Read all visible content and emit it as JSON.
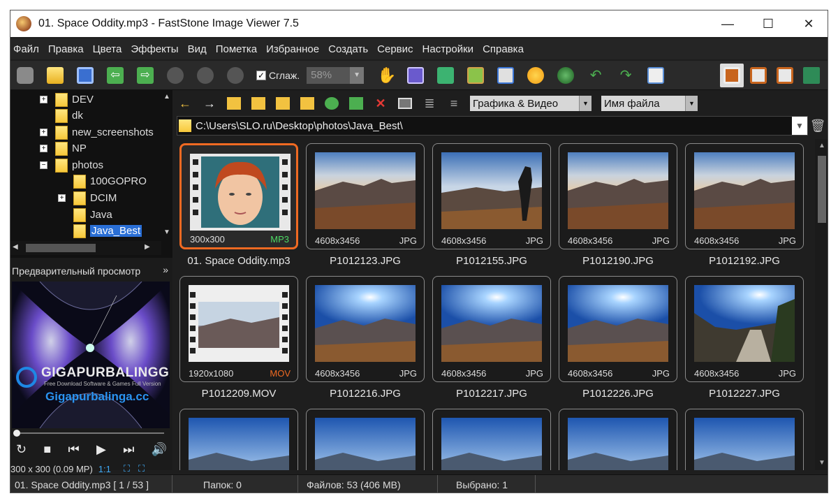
{
  "window": {
    "title": "01. Space Oddity.mp3  -  FastStone Image Viewer 7.5",
    "controls": [
      "—",
      "☐",
      "✕"
    ]
  },
  "menu": [
    "Файл",
    "Правка",
    "Цвета",
    "Эффекты",
    "Вид",
    "Пометка",
    "Избранное",
    "Создать",
    "Сервис",
    "Настройки",
    "Справка"
  ],
  "toolbar": {
    "smooth_label": "Сглаж.",
    "zoom_value": "58%"
  },
  "tree": [
    {
      "label": "DEV",
      "expander": "+"
    },
    {
      "label": "dk",
      "expander": ""
    },
    {
      "label": "new_screenshots",
      "expander": "+"
    },
    {
      "label": "NP",
      "expander": "+"
    },
    {
      "label": "photos",
      "expander": "−"
    },
    {
      "label": "100GOPRO",
      "expander": ""
    },
    {
      "label": "DCIM",
      "expander": "+"
    },
    {
      "label": "Java",
      "expander": ""
    },
    {
      "label": "Java_Best",
      "expander": ""
    }
  ],
  "preview": {
    "header": "Предварительный просмотр",
    "info": "300 x 300 (0.09 MP)",
    "ratio": "1:1",
    "watermark_brand": "GIGAPURBALINGGA",
    "watermark_tagline": "Free Download Software & Games Full Version",
    "watermark_site": "Gigapurbalinga.cc"
  },
  "filters": {
    "type": "Графика & Видео",
    "sort": "Имя файла"
  },
  "path": "C:\\Users\\SLO.ru\\Desktop\\photos\\Java_Best\\",
  "thumbnails": [
    {
      "dims": "300x300",
      "ext": "MP3",
      "name": "01. Space Oddity.mp3",
      "kind": "portrait",
      "selected": true
    },
    {
      "dims": "4608x3456",
      "ext": "JPG",
      "name": "P1012123.JPG",
      "kind": "dusk"
    },
    {
      "dims": "4608x3456",
      "ext": "JPG",
      "name": "P1012155.JPG",
      "kind": "person"
    },
    {
      "dims": "4608x3456",
      "ext": "JPG",
      "name": "P1012190.JPG",
      "kind": "dusk"
    },
    {
      "dims": "4608x3456",
      "ext": "JPG",
      "name": "P1012192.JPG",
      "kind": "dusk"
    },
    {
      "dims": "1920x1080",
      "ext": "MOV",
      "name": "P1012209.MOV",
      "kind": "film"
    },
    {
      "dims": "4608x3456",
      "ext": "JPG",
      "name": "P1012216.JPG",
      "kind": "sun"
    },
    {
      "dims": "4608x3456",
      "ext": "JPG",
      "name": "P1012217.JPG",
      "kind": "sun"
    },
    {
      "dims": "4608x3456",
      "ext": "JPG",
      "name": "P1012226.JPG",
      "kind": "sun"
    },
    {
      "dims": "4608x3456",
      "ext": "JPG",
      "name": "P1012227.JPG",
      "kind": "road"
    },
    {
      "dims": "",
      "ext": "",
      "name": "",
      "kind": "sky"
    },
    {
      "dims": "",
      "ext": "",
      "name": "",
      "kind": "sky"
    },
    {
      "dims": "",
      "ext": "",
      "name": "",
      "kind": "sky"
    },
    {
      "dims": "",
      "ext": "",
      "name": "",
      "kind": "sky"
    },
    {
      "dims": "",
      "ext": "",
      "name": "",
      "kind": "sky"
    }
  ],
  "status": {
    "file": "01. Space Oddity.mp3 [ 1 / 53 ]",
    "folders": "Папок: 0",
    "files": "Файлов: 53 (406 MB)",
    "selected": "Выбрано: 1"
  },
  "colors": {
    "selection": "#f06a22",
    "mp3": "#4cd964",
    "mov": "#f06a22",
    "accent": "#3fa9f5"
  },
  "icons": {
    "toolbar": [
      "camera-icon",
      "open-folder-icon",
      "save-icon",
      "previous-icon",
      "next-icon",
      "zoom-in-icon",
      "zoom-out-icon",
      "actual-size-icon"
    ],
    "toolbar2": [
      "hand-icon",
      "slideshow-icon",
      "batch-convert-icon",
      "crop-icon",
      "resize-icon",
      "brightness-icon",
      "wallpaper-icon",
      "rotate-left-icon",
      "rotate-right-icon",
      "compare-icon"
    ],
    "view": [
      "thumbnails-view-icon",
      "browser-view-icon",
      "image-view-icon",
      "fullscreen-icon"
    ],
    "nav": [
      "back-icon",
      "forward-icon",
      "up-folder-icon",
      "refresh-icon",
      "new-folder-icon",
      "favorite-folder-icon",
      "copy-icon",
      "move-icon",
      "delete-icon",
      "detail-view-icon",
      "list-view-icon",
      "tile-view-icon"
    ]
  }
}
